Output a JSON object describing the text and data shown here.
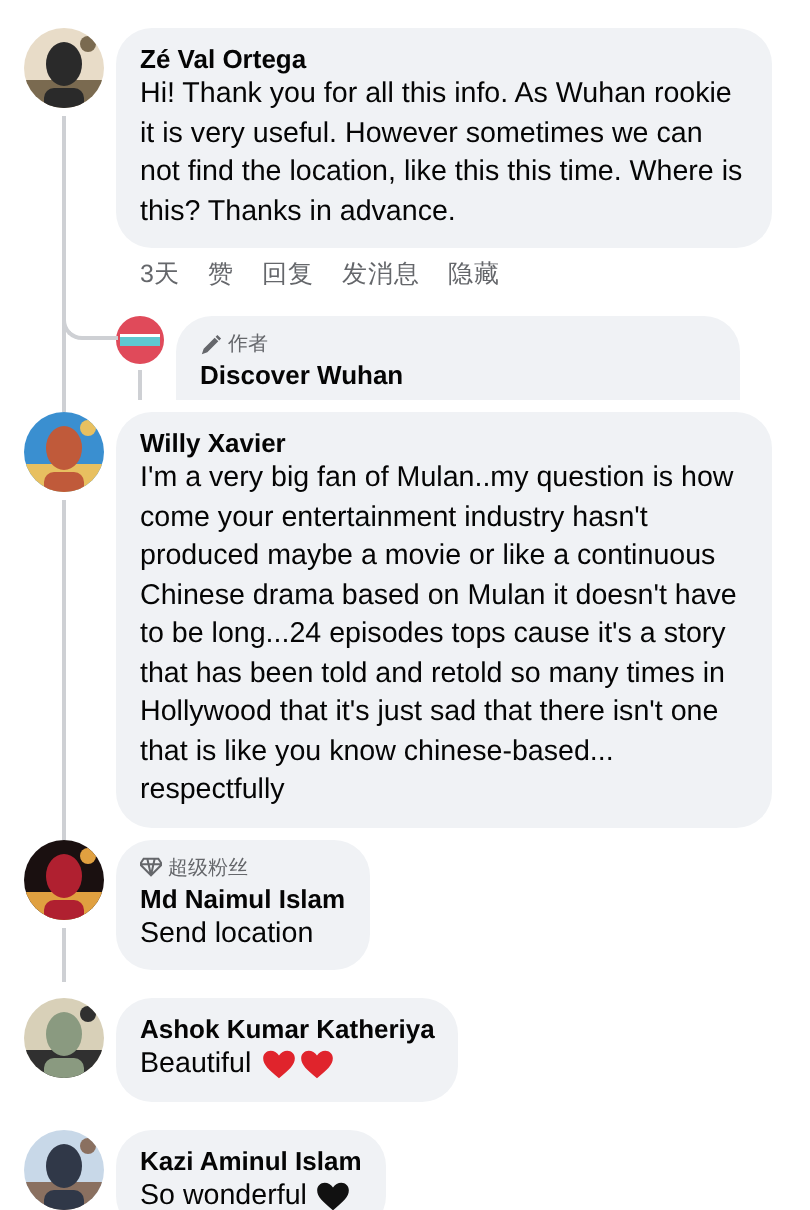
{
  "comments": [
    {
      "author": "Zé Val Ortega",
      "text": "Hi! Thank you for all this info. As Wuhan rookie it is very useful. However sometimes we can not find the location, like this this time. Where is this? Thanks in advance.",
      "thread_line": true,
      "actions": [
        "3天",
        "赞",
        "回复",
        "发消息",
        "隐藏"
      ],
      "replies": [
        {
          "badge": {
            "kind": "author",
            "label": "作者"
          },
          "author": "Discover Wuhan"
        }
      ]
    },
    {
      "author": "Willy Xavier",
      "text": "I'm a very big fan of Mulan..my question is how come your entertainment industry hasn't produced maybe a movie or like a continuous Chinese drama based on Mulan it doesn't have to be long...24 episodes tops cause it's a story that has been told and retold so many times in Hollywood that it's just sad that there isn't one that is like you know chinese-based... respectfully",
      "thread_line": true
    },
    {
      "badge": {
        "kind": "superfan",
        "label": "超级粉丝"
      },
      "author": "Md Naimul Islam",
      "text": "Send location",
      "thread_line": true
    },
    {
      "author": "Ashok Kumar Katheriya",
      "text": "Beautiful",
      "thread_line": false,
      "emoji": [
        {
          "kind": "red-heart"
        },
        {
          "kind": "red-heart"
        }
      ]
    },
    {
      "author": "Kazi Aminul Islam",
      "text": "So wonderful",
      "thread_line": false,
      "emoji": [
        {
          "kind": "black-heart"
        }
      ]
    }
  ]
}
